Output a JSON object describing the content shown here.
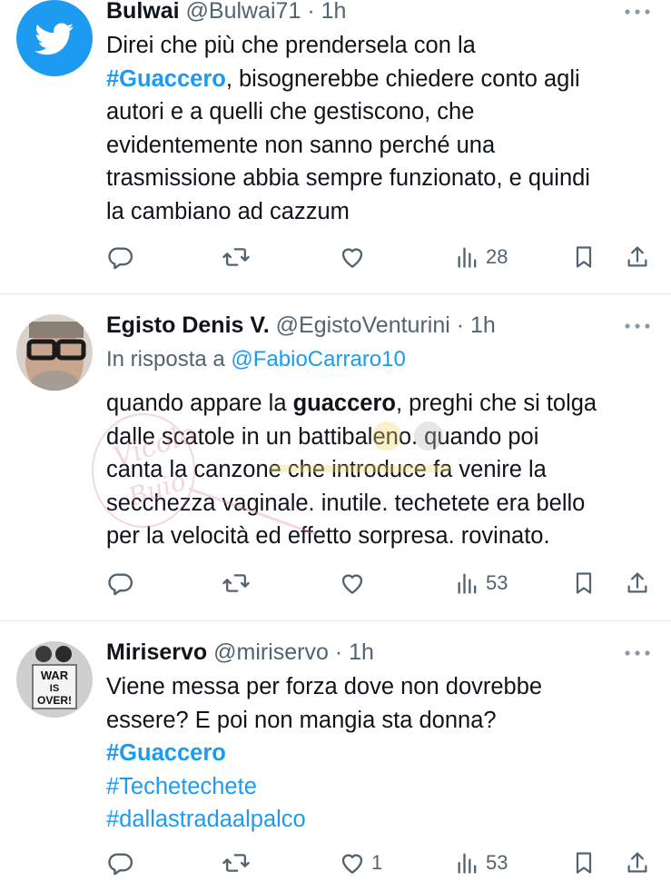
{
  "tweets": [
    {
      "name": "Bulwai",
      "handle": "@Bulwai71",
      "time": "1h",
      "lines": [
        [
          {
            "t": "Direi che più che prendersela con la"
          }
        ],
        [
          {
            "t": "#Guaccero",
            "s": "tag-bold"
          },
          {
            "t": ", bisognerebbe chiedere conto agli"
          }
        ],
        [
          {
            "t": "autori e a quelli che gestiscono, che"
          }
        ],
        [
          {
            "t": "evidentemente non sanno perché una"
          }
        ],
        [
          {
            "t": "trasmissione abbia sempre funzionato, e quindi"
          }
        ],
        [
          {
            "t": "la cambiano ad cazzum"
          }
        ]
      ],
      "stats": {
        "replies": "",
        "retweets": "",
        "likes": "",
        "views": "28"
      }
    },
    {
      "name": "Egisto Denis V.",
      "handle": "@EgistoVenturini",
      "time": "1h",
      "reply_prefix": "In risposta a",
      "reply_to": "@FabioCarraro10",
      "lines": [
        [
          {
            "t": "quando appare la "
          },
          {
            "t": "guaccero",
            "s": "bold"
          },
          {
            "t": ", preghi che si tolga"
          }
        ],
        [
          {
            "t": "dalle scatole in un battibaleno. quando poi"
          }
        ],
        [
          {
            "t": "canta la canzone che introduce fa venire la"
          }
        ],
        [
          {
            "t": "secchezza vaginale. inutile. techetete era bello"
          }
        ],
        [
          {
            "t": "per la velocità ed effetto sorpresa. rovinato."
          }
        ]
      ],
      "stats": {
        "replies": "",
        "retweets": "",
        "likes": "",
        "views": "53"
      }
    },
    {
      "name": "Miriservo",
      "handle": "@miriservo",
      "time": "1h",
      "lines": [
        [
          {
            "t": "Viene messa per forza dove non dovrebbe"
          }
        ],
        [
          {
            "t": "essere? E poi non mangia sta donna?"
          }
        ],
        [
          {
            "t": "#Guaccero",
            "s": "tag-bold"
          }
        ],
        [
          {
            "t": "#Techetechete",
            "s": "tag"
          }
        ],
        [
          {
            "t": "#dallastradaalpalco",
            "s": "tag"
          }
        ]
      ],
      "stats": {
        "replies": "",
        "retweets": "",
        "likes": "1",
        "views": "53"
      }
    }
  ],
  "avatar3_sign": [
    "WAR",
    "IS",
    "OVER!"
  ],
  "watermark_text": [
    "Vicolo",
    "Buio"
  ],
  "icons": {
    "reply": "reply-icon",
    "retweet": "retweet-icon",
    "like": "heart-icon",
    "views": "views-icon",
    "bookmark": "bookmark-icon",
    "share": "share-icon",
    "more": "more-icon"
  },
  "colors": {
    "accent": "#1d9bf0",
    "text": "#0f1419",
    "muted": "#536471",
    "divider": "#e6e9eb"
  }
}
